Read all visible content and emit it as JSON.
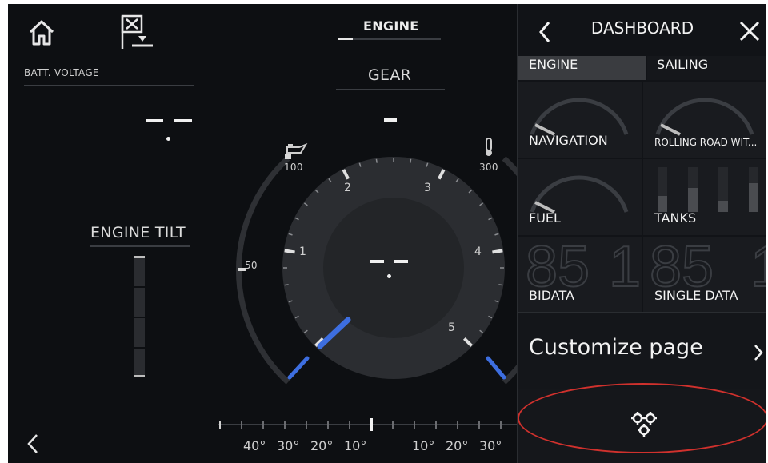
{
  "header": {
    "home_icon": "home-icon",
    "flag_icon": "man-overboard-flag-icon",
    "engine_tab": "ENGINE"
  },
  "left": {
    "batt_label": "BATT. VOLTAGE",
    "batt_value": "- -",
    "tilt_label": "ENGINE TILT",
    "back_icon": "chevron-left-icon"
  },
  "gauge": {
    "gear_label": "GEAR",
    "gear_value": "-",
    "rpm_value": "- -",
    "rpm_ticks": [
      "1",
      "2",
      "3",
      "4",
      "5"
    ],
    "oil_icon": "oil-can-icon",
    "temp_icon": "thermometer-icon",
    "oil_ticks": [
      "100",
      "50"
    ],
    "temp_ticks": [
      "300"
    ],
    "needle_color": "#3d6ee0"
  },
  "trim": {
    "angles": [
      "40°",
      "30°",
      "20°",
      "10°",
      "10°",
      "20°",
      "30°"
    ]
  },
  "panel": {
    "back_icon": "chevron-left-icon",
    "title": "DASHBOARD",
    "close_icon": "close-icon",
    "tabs": [
      {
        "label": "ENGINE",
        "active": true
      },
      {
        "label": "SAILING",
        "active": false
      }
    ],
    "tiles": [
      {
        "label": "NAVIGATION"
      },
      {
        "label": "ROLLING ROAD WIT..."
      },
      {
        "label": "FUEL"
      },
      {
        "label": "TANKS"
      },
      {
        "label": "BIDATA"
      },
      {
        "label": "SINGLE DATA"
      }
    ],
    "customize_label": "Customize page",
    "customize_chevron": "chevron-right-icon",
    "gears_icon": "gears-icon",
    "highlight_color": "#d0312d"
  }
}
